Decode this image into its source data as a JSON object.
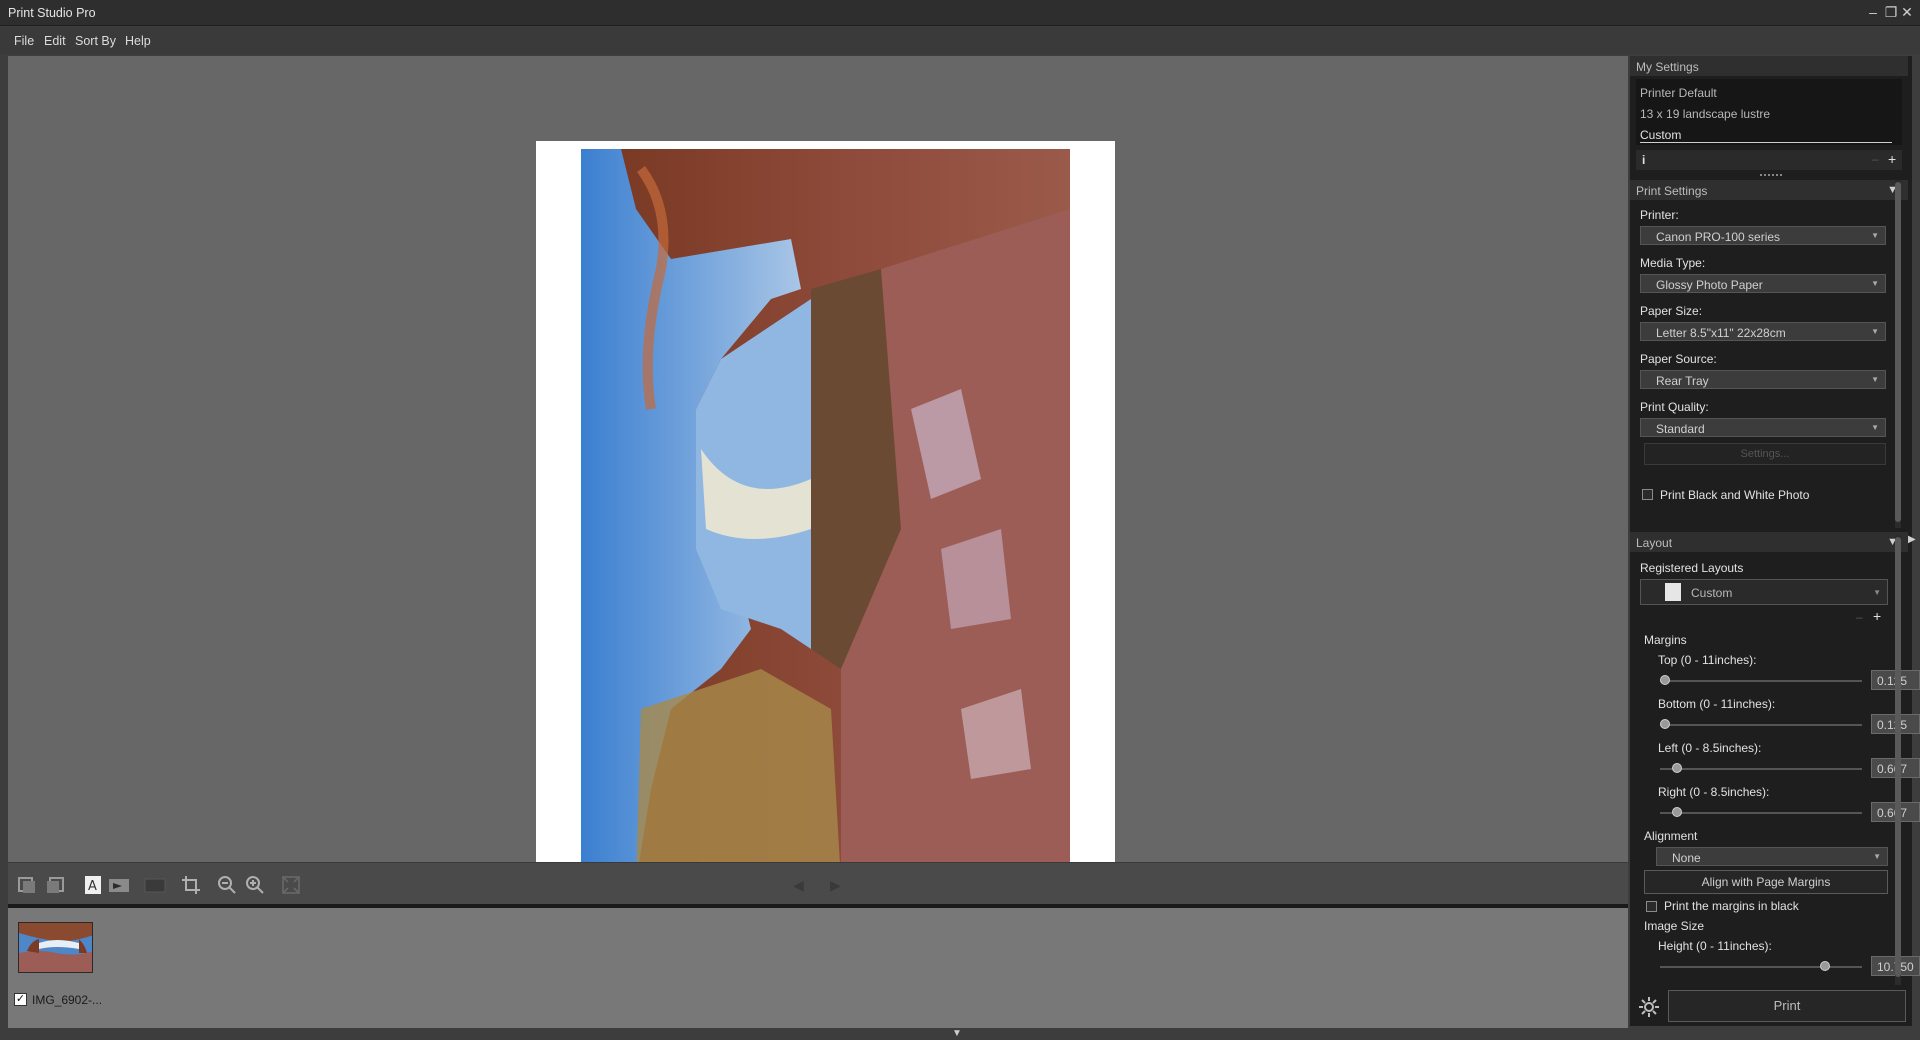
{
  "window": {
    "title": "Print Studio Pro",
    "minimize": "–",
    "restore": "❐",
    "close": "✕"
  },
  "menu": [
    {
      "label": "File"
    },
    {
      "label": "Edit"
    },
    {
      "label": "Sort By"
    },
    {
      "label": "Help"
    }
  ],
  "thumbnail": {
    "name": "IMG_6902-...",
    "checked": true
  },
  "my_settings": {
    "header": "My Settings",
    "items": [
      "Printer Default",
      "13 x 19 landscape lustre",
      "Custom"
    ],
    "info_icon": "i",
    "add": "+",
    "remove": "–"
  },
  "print_settings": {
    "header": "Print Settings",
    "printer_label": "Printer:",
    "printer_value": "Canon PRO-100 series",
    "media_label": "Media Type:",
    "media_value": "Glossy Photo Paper",
    "paper_size_label": "Paper Size:",
    "paper_size_value": "Letter 8.5\"x11\" 22x28cm",
    "paper_source_label": "Paper Source:",
    "paper_source_value": "Rear Tray",
    "quality_label": "Print Quality:",
    "quality_value": "Standard",
    "settings_button": "Settings...",
    "bw_label": "Print Black and White Photo"
  },
  "layout": {
    "header": "Layout",
    "registered_label": "Registered Layouts",
    "registered_value": "Custom",
    "margins_label": "Margins",
    "top_label": "Top (0 - 11inches):",
    "top_value": "0.125",
    "bottom_label": "Bottom (0 - 11inches):",
    "bottom_value": "0.125",
    "left_label": "Left (0 - 8.5inches):",
    "left_value": "0.667",
    "right_label": "Right (0 - 8.5inches):",
    "right_value": "0.667",
    "alignment_label": "Alignment",
    "alignment_value": "None",
    "align_button": "Align with Page Margins",
    "margins_black_label": "Print the margins in black",
    "image_size_label": "Image Size",
    "height_label": "Height (0 - 11inches):",
    "height_value": "10.750"
  },
  "print_button": "Print"
}
